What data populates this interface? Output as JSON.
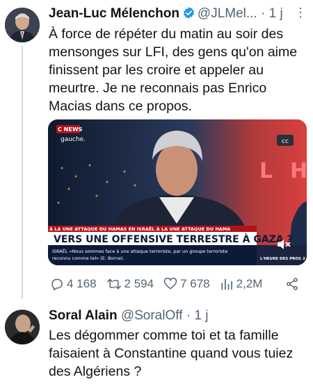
{
  "tweet1": {
    "name": "Jean-Luc Mélenchon",
    "handle": "@JLMel...",
    "dot": "·",
    "time": "1 j",
    "more": "⋮",
    "text": "À force de répéter du matin au soir des mensonges sur LFI, des gens qu'on aime finissent par les croire et appeler au meurtre. Je ne reconnais pas Enrico Macias dans ce propos.",
    "media": {
      "channel": "C NEWS",
      "corner_tag": "gauche.",
      "cc": "cc",
      "ticker": "À LA UNE   ATTAQUE DU HAMAS EN ISRAËL   À LA UNE   ATTAQUE DU HAMA",
      "headline": "VERS UNE OFFENSIVE TERRESTRE À GAZA ?",
      "subtitle_line1": "ISRAËL  «Nous sommes face à une attaque terroriste, par un groupe terroriste",
      "subtitle_line2": "reconnu comme tel» (E. Borne).",
      "badge": "L'HEURE DES PROS 2"
    },
    "stats": {
      "replies": "4 168",
      "retweets": "2 594",
      "likes": "7 678",
      "views": "2,2M"
    }
  },
  "tweet2": {
    "name": "Soral Alain",
    "handle": "@SoralOff",
    "dot": "·",
    "time": "1 j",
    "text": "Les dégommer comme toi et ta famille faisaient à Constantine quand vous tuiez des Algériens ?"
  },
  "colors": {
    "text": "#0f1419",
    "secondary": "#536471",
    "verified": "#1d9bf0",
    "thread_line": "#cfd9de"
  }
}
